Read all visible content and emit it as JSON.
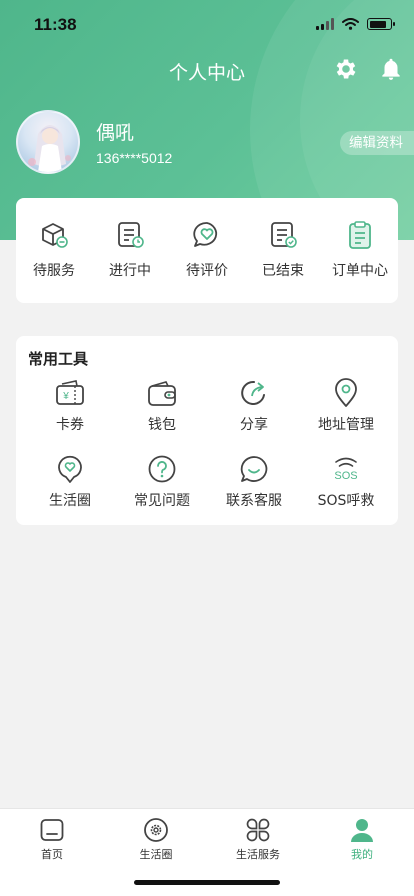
{
  "status": {
    "time": "11:38"
  },
  "header": {
    "title": "个人中心"
  },
  "profile": {
    "name": "偶吼",
    "phone": "136****5012",
    "edit_label": "编辑资料"
  },
  "orders": [
    {
      "label": "待服务",
      "icon": "package-icon"
    },
    {
      "label": "进行中",
      "icon": "list-clock-icon"
    },
    {
      "label": "待评价",
      "icon": "heart-chat-icon"
    },
    {
      "label": "已结束",
      "icon": "list-check-icon"
    },
    {
      "label": "订单中心",
      "icon": "clipboard-icon"
    }
  ],
  "tools": {
    "title": "常用工具",
    "items": [
      {
        "label": "卡券",
        "icon": "coupon-icon"
      },
      {
        "label": "钱包",
        "icon": "wallet-icon"
      },
      {
        "label": "分享",
        "icon": "share-icon"
      },
      {
        "label": "地址管理",
        "icon": "location-icon"
      },
      {
        "label": "生活圈",
        "icon": "heart-bubble-icon"
      },
      {
        "label": "常见问题",
        "icon": "question-icon"
      },
      {
        "label": "联系客服",
        "icon": "chat-icon"
      },
      {
        "label": "SOS呼救",
        "icon": "sos-icon"
      }
    ],
    "sos_text": "SOS",
    "coupon_symbol": "¥"
  },
  "tabbar": [
    {
      "label": "首页",
      "icon": "home-icon"
    },
    {
      "label": "生活圈",
      "icon": "circle-gear-icon"
    },
    {
      "label": "生活服务",
      "icon": "grid-icon"
    },
    {
      "label": "我的",
      "icon": "person-icon"
    }
  ],
  "colors": {
    "accent": "#4fb68b",
    "active_tab": "#3db07e"
  }
}
